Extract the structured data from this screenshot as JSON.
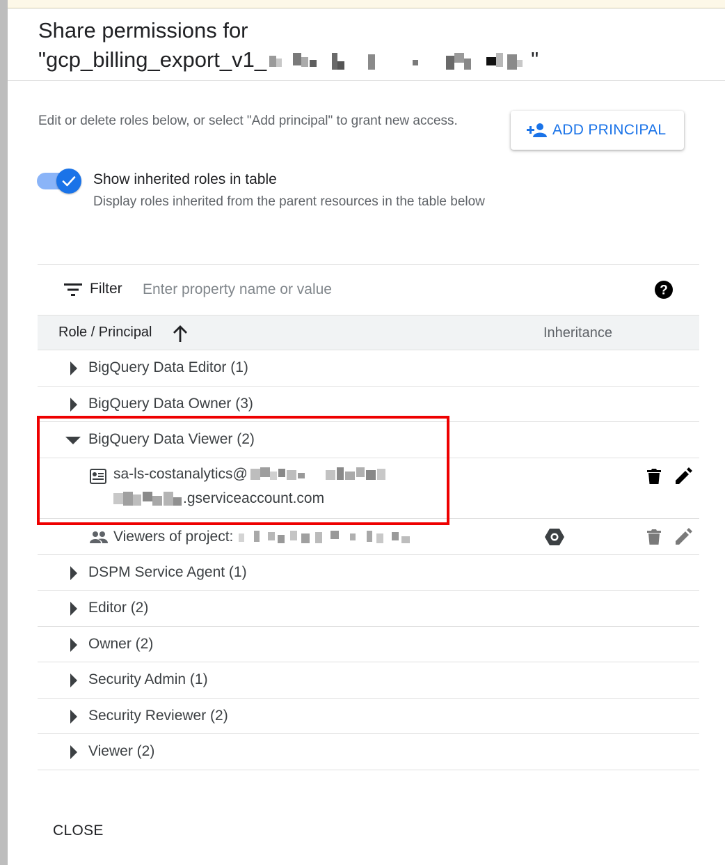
{
  "dialog": {
    "title_line1": "Share permissions for",
    "title_line2_prefix": "\"gcp_billing_export_v1_",
    "title_line2_suffix": "\"",
    "description": "Edit or delete roles below, or select \"Add principal\" to grant new access.",
    "add_principal_label": "ADD PRINCIPAL",
    "toggle_label": "Show inherited roles in table",
    "toggle_sublabel": "Display roles inherited from the parent resources in the table below",
    "toggle_on": true,
    "close_label": "CLOSE"
  },
  "filter": {
    "label": "Filter",
    "placeholder": "Enter property name or value"
  },
  "table": {
    "col_role": "Role / Principal",
    "col_inheritance": "Inheritance",
    "roles": [
      {
        "name": "BigQuery Data Editor (1)",
        "expanded": false
      },
      {
        "name": "BigQuery Data Owner (3)",
        "expanded": false
      },
      {
        "name": "BigQuery Data Viewer (2)",
        "expanded": true
      },
      {
        "name": "DSPM Service Agent (1)",
        "expanded": false
      },
      {
        "name": "Editor (2)",
        "expanded": false
      },
      {
        "name": "Owner (2)",
        "expanded": false
      },
      {
        "name": "Security Admin (1)",
        "expanded": false
      },
      {
        "name": "Security Reviewer (2)",
        "expanded": false
      },
      {
        "name": "Viewer (2)",
        "expanded": false
      }
    ],
    "members": {
      "service_account_prefix": "sa-ls-costanalytics@",
      "service_account_suffix": ".gserviceaccount.com",
      "group_prefix": "Viewers of project:"
    }
  },
  "colors": {
    "accent": "#1a73e8",
    "highlight": "#ee0000"
  }
}
